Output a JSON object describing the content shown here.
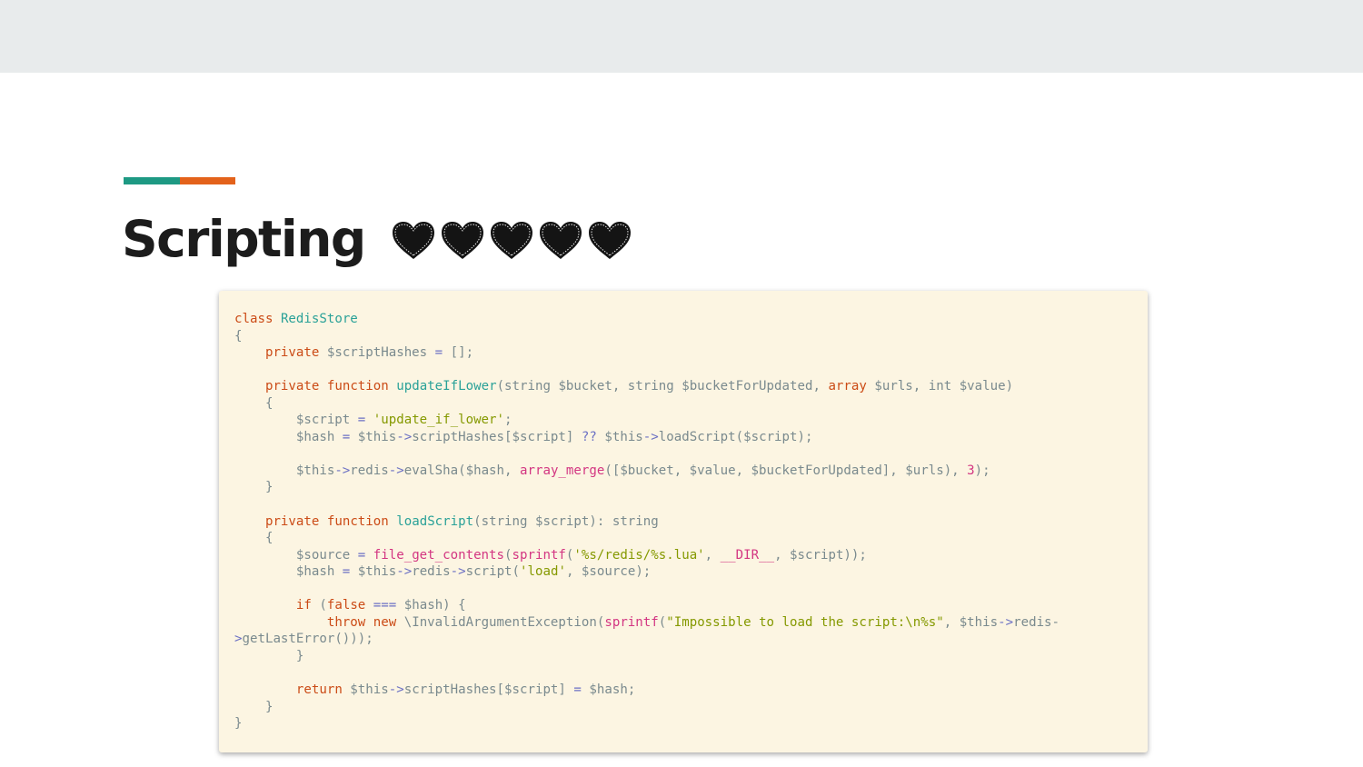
{
  "slide": {
    "title": "Scripting",
    "heart_count": 5,
    "accent_colors": {
      "teal": "#1e9983",
      "orange": "#e3621b"
    }
  },
  "code": {
    "lines": [
      [
        [
          "kw",
          "class"
        ],
        [
          "t",
          " "
        ],
        [
          "cls",
          "RedisStore"
        ]
      ],
      [
        [
          "t",
          "{"
        ]
      ],
      [
        [
          "t",
          "    "
        ],
        [
          "kw",
          "private"
        ],
        [
          "t",
          " $scriptHashes "
        ],
        [
          "op",
          "="
        ],
        [
          "t",
          " [];"
        ]
      ],
      [],
      [
        [
          "t",
          "    "
        ],
        [
          "kw",
          "private"
        ],
        [
          "t",
          " "
        ],
        [
          "kw",
          "function"
        ],
        [
          "t",
          " "
        ],
        [
          "cls",
          "updateIfLower"
        ],
        [
          "t",
          "(string $bucket, string $bucketForUpdated, "
        ],
        [
          "kw",
          "array"
        ],
        [
          "t",
          " $urls, int $value)"
        ]
      ],
      [
        [
          "t",
          "    {"
        ]
      ],
      [
        [
          "t",
          "        $script "
        ],
        [
          "op",
          "="
        ],
        [
          "t",
          " "
        ],
        [
          "str",
          "'update_if_lower'"
        ],
        [
          "t",
          ";"
        ]
      ],
      [
        [
          "t",
          "        $hash "
        ],
        [
          "op",
          "="
        ],
        [
          "t",
          " $this"
        ],
        [
          "op",
          "->"
        ],
        [
          "t",
          "scriptHashes[$script] "
        ],
        [
          "op",
          "??"
        ],
        [
          "t",
          " $this"
        ],
        [
          "op",
          "->"
        ],
        [
          "t",
          "loadScript($script);"
        ]
      ],
      [],
      [
        [
          "t",
          "        $this"
        ],
        [
          "op",
          "->"
        ],
        [
          "t",
          "redis"
        ],
        [
          "op",
          "->"
        ],
        [
          "t",
          "evalSha($hash, "
        ],
        [
          "bi",
          "array_merge"
        ],
        [
          "t",
          "([$bucket, $value, $bucketForUpdated], $urls), "
        ],
        [
          "num",
          "3"
        ],
        [
          "t",
          ");"
        ]
      ],
      [
        [
          "t",
          "    }"
        ]
      ],
      [],
      [
        [
          "t",
          "    "
        ],
        [
          "kw",
          "private"
        ],
        [
          "t",
          " "
        ],
        [
          "kw",
          "function"
        ],
        [
          "t",
          " "
        ],
        [
          "cls",
          "loadScript"
        ],
        [
          "t",
          "(string $script): string"
        ]
      ],
      [
        [
          "t",
          "    {"
        ]
      ],
      [
        [
          "t",
          "        $source "
        ],
        [
          "op",
          "="
        ],
        [
          "t",
          " "
        ],
        [
          "bi",
          "file_get_contents"
        ],
        [
          "t",
          "("
        ],
        [
          "bi",
          "sprintf"
        ],
        [
          "t",
          "("
        ],
        [
          "str",
          "'%s/redis/%s.lua'"
        ],
        [
          "t",
          ", "
        ],
        [
          "bi",
          "__DIR__"
        ],
        [
          "t",
          ", $script));"
        ]
      ],
      [
        [
          "t",
          "        $hash "
        ],
        [
          "op",
          "="
        ],
        [
          "t",
          " $this"
        ],
        [
          "op",
          "->"
        ],
        [
          "t",
          "redis"
        ],
        [
          "op",
          "->"
        ],
        [
          "t",
          "script("
        ],
        [
          "str",
          "'load'"
        ],
        [
          "t",
          ", $source);"
        ]
      ],
      [],
      [
        [
          "t",
          "        "
        ],
        [
          "kw",
          "if"
        ],
        [
          "t",
          " ("
        ],
        [
          "kw",
          "false"
        ],
        [
          "t",
          " "
        ],
        [
          "op",
          "==="
        ],
        [
          "t",
          " $hash) {"
        ]
      ],
      [
        [
          "t",
          "            "
        ],
        [
          "kw",
          "throw"
        ],
        [
          "t",
          " "
        ],
        [
          "kw",
          "new"
        ],
        [
          "t",
          " \\InvalidArgumentException("
        ],
        [
          "bi",
          "sprintf"
        ],
        [
          "t",
          "("
        ],
        [
          "str",
          "\"Impossible to load the script:\\n%s\""
        ],
        [
          "t",
          ", $this"
        ],
        [
          "op",
          "->"
        ],
        [
          "t",
          "redis-"
        ]
      ],
      [
        [
          "op",
          ">"
        ],
        [
          "t",
          "getLastError()));"
        ]
      ],
      [
        [
          "t",
          "        }"
        ]
      ],
      [],
      [
        [
          "t",
          "        "
        ],
        [
          "kw",
          "return"
        ],
        [
          "t",
          " $this"
        ],
        [
          "op",
          "->"
        ],
        [
          "t",
          "scriptHashes[$script] "
        ],
        [
          "op",
          "="
        ],
        [
          "t",
          " $hash;"
        ]
      ],
      [
        [
          "t",
          "    }"
        ]
      ],
      [
        [
          "t",
          "}"
        ]
      ]
    ]
  }
}
